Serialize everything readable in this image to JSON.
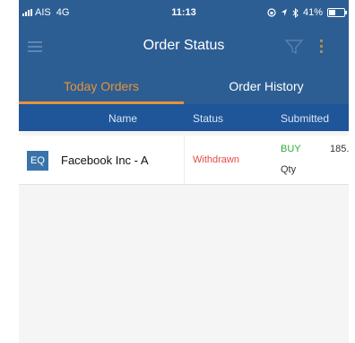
{
  "status_bar": {
    "carrier": "AIS",
    "network": "4G",
    "time": "11:13",
    "battery": "41%"
  },
  "header": {
    "title": "Order Status"
  },
  "tabs": [
    {
      "label": "Today Orders",
      "active": true
    },
    {
      "label": "Order History",
      "active": false
    }
  ],
  "columns": {
    "name": "Name",
    "status": "Status",
    "submitted": "Submitted"
  },
  "orders": [
    {
      "badge": "EQ",
      "name": "Facebook Inc - A",
      "status": "Withdrawn",
      "side": "BUY",
      "price": "185.",
      "qty_label": "Qty"
    }
  ],
  "colors": {
    "header_bg": "#2d5e93",
    "column_header_bg": "#1f5599",
    "accent": "#e8923a",
    "withdrawn": "#e64a44",
    "buy": "#2eaa3a",
    "badge_bg": "#3a73aa"
  },
  "icons": {
    "menu": "hamburger-icon",
    "filter": "filter-icon",
    "more": "more-vertical-icon"
  }
}
